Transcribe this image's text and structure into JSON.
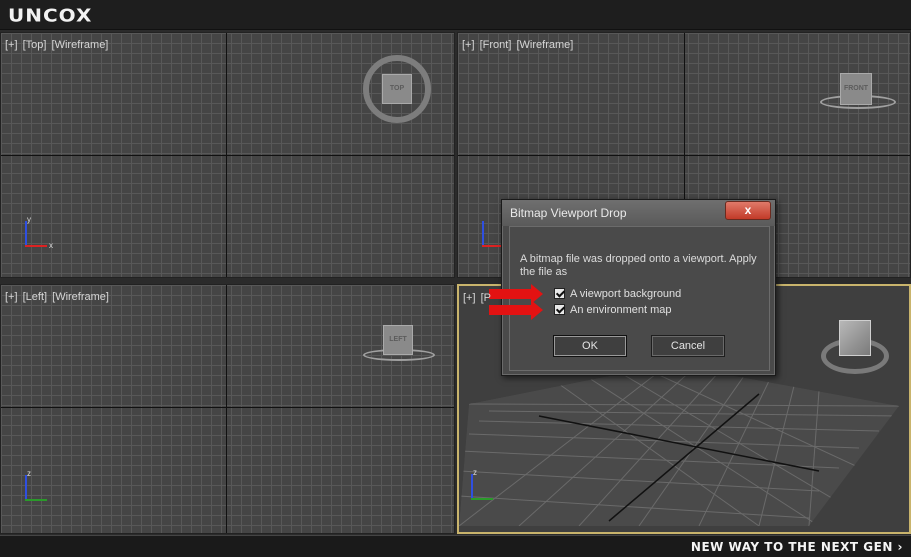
{
  "app": {
    "logo": "UNCOX",
    "tagline": "NEW WAY TO THE NEXT GEN ›"
  },
  "viewports": {
    "top": {
      "parts": [
        "[+]",
        "[Top]",
        "[Wireframe]"
      ],
      "cube_label": "TOP"
    },
    "front": {
      "parts": [
        "[+]",
        "[Front]",
        "[Wireframe]"
      ],
      "cube_label": "FRONT"
    },
    "left": {
      "parts": [
        "[+]",
        "[Left]",
        "[Wireframe]"
      ],
      "cube_label": "LEFT"
    },
    "persp": {
      "parts": [
        "[+]",
        "[P"
      ],
      "cube_label": ""
    }
  },
  "axes": {
    "z": "z",
    "x": "x",
    "y": "y"
  },
  "dialog": {
    "title": "Bitmap Viewport Drop",
    "close_label": "x",
    "message": "A bitmap file was dropped onto a viewport. Apply the file as",
    "option_background": "A viewport background",
    "option_environment": "An environment map",
    "ok_label": "OK",
    "cancel_label": "Cancel"
  },
  "colors": {
    "accent_arrow": "#e31212",
    "active_viewport_border": "#c9b46c",
    "close_button": "#c23a28"
  }
}
